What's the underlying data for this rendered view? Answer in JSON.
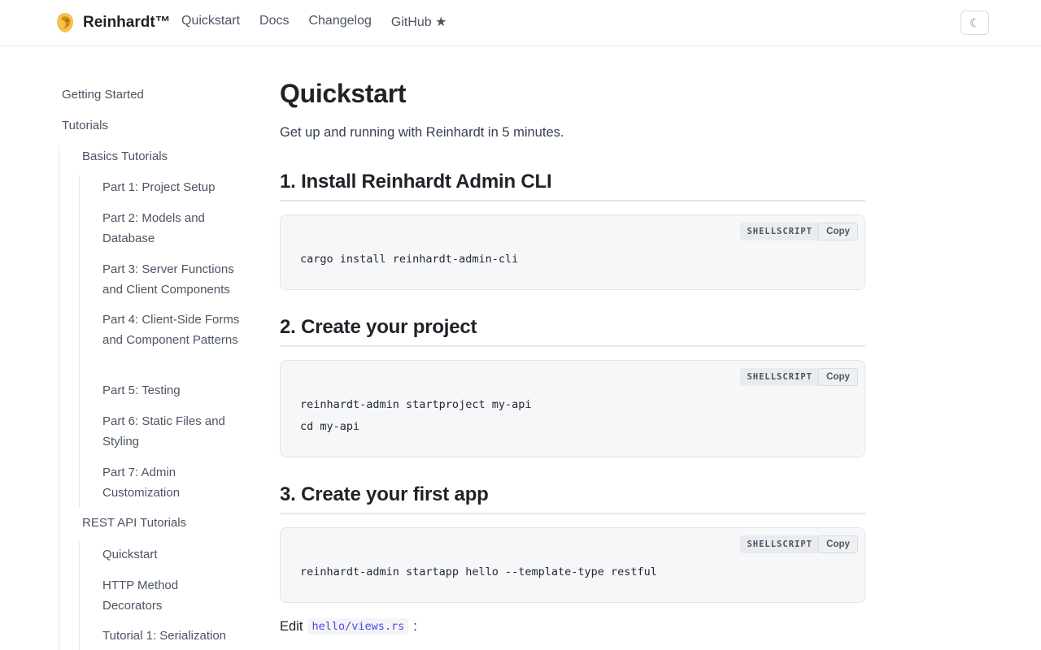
{
  "header": {
    "brand": "Reinhardt™",
    "nav": [
      "Quickstart",
      "Docs",
      "Changelog",
      "GitHub ★"
    ],
    "theme_toggle_icon": "☾"
  },
  "sidebar": {
    "items": [
      "Getting Started",
      "Tutorials",
      "Basics Tutorials",
      "Part 1: Project Setup",
      "Part 2: Models and Database",
      "Part 3: Server Functions and Client Components",
      "Part 4: Client-Side Forms and Component Patterns",
      "Part 5: Testing",
      "Part 6: Static Files and Styling",
      "Part 7: Admin Customization",
      "REST API Tutorials",
      "Quickstart",
      "HTTP Method Decorators",
      "Tutorial 1: Serialization"
    ]
  },
  "content": {
    "title": "Quickstart",
    "lead": "Get up and running with Reinhardt in 5 minutes.",
    "sections": [
      {
        "heading": "1. Install Reinhardt Admin CLI",
        "lang": "SHELLSCRIPT",
        "copy": "Copy",
        "lines": [
          "cargo install reinhardt-admin-cli"
        ]
      },
      {
        "heading": "2. Create your project",
        "lang": "SHELLSCRIPT",
        "copy": "Copy",
        "lines": [
          "reinhardt-admin startproject my-api",
          "cd my-api"
        ]
      },
      {
        "heading": "3. Create your first app",
        "lang": "SHELLSCRIPT",
        "copy": "Copy",
        "lines": [
          "reinhardt-admin startapp hello --template-type restful"
        ]
      }
    ],
    "edit_prefix": "Edit",
    "edit_file": "hello/views.rs",
    "edit_suffix": ":"
  },
  "colors": {
    "progress": "#c8412f",
    "inline_code": "#4f46e5",
    "logo": "#e0a526"
  }
}
